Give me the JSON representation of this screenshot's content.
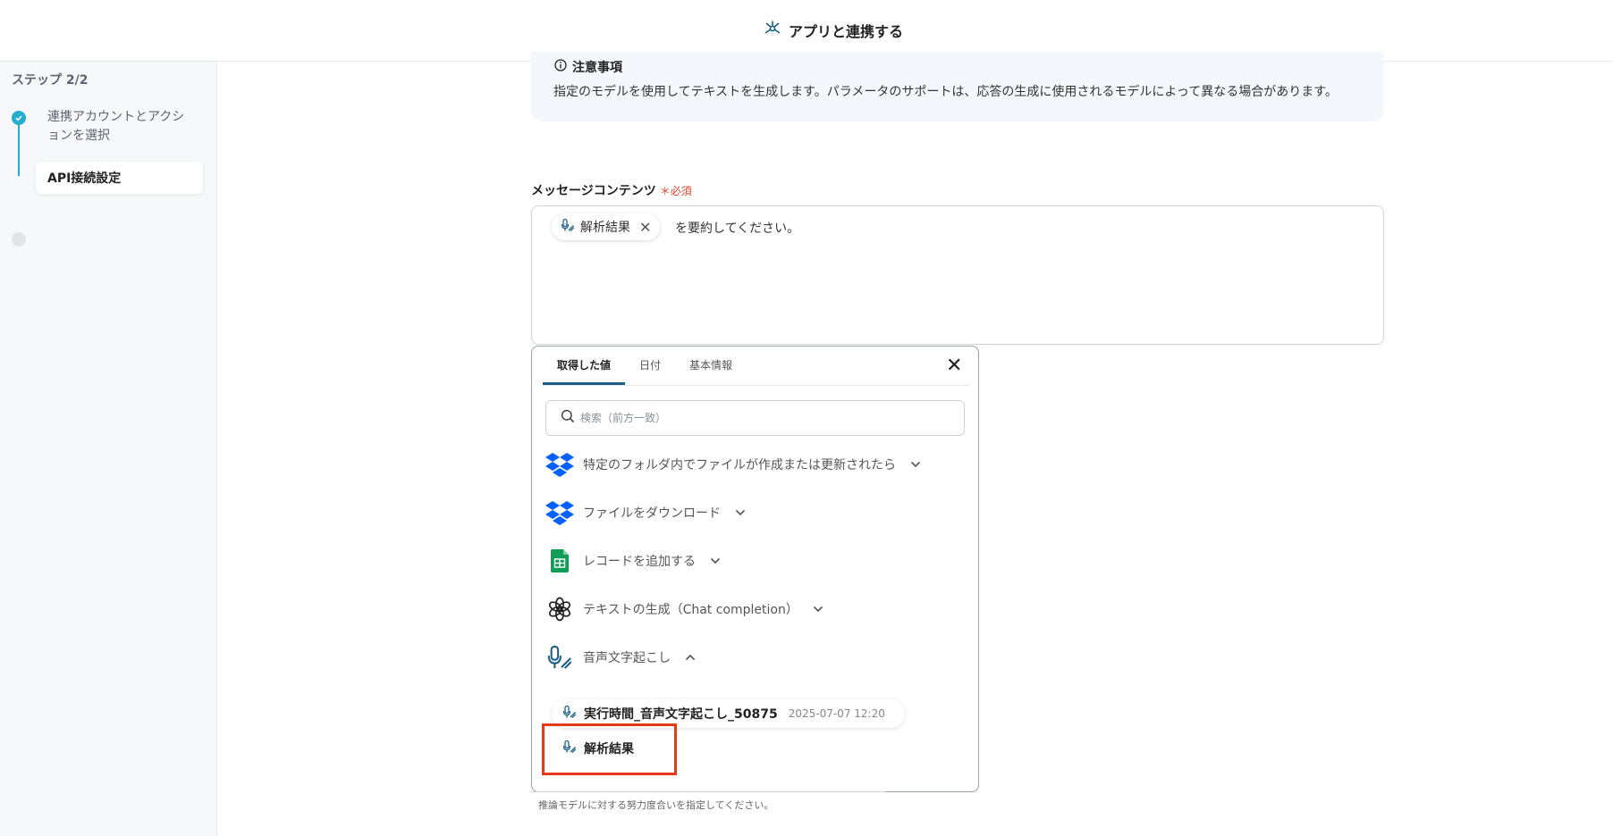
{
  "header": {
    "title": "アプリと連携する",
    "icon": "hub-icon"
  },
  "sidebar": {
    "step_label": "ステップ 2/2",
    "steps": [
      {
        "label": "連携アカウントとアクションを選択",
        "status": "done"
      },
      {
        "label": "API接続設定",
        "status": "current"
      }
    ]
  },
  "notice": {
    "title": "注意事項",
    "text": "指定のモデルを使用してテキストを生成します。パラメータのサポートは、応答の生成に使用されるモデルによって異なる場合があります。"
  },
  "message_field": {
    "label": "メッセージコンテンツ",
    "required_label": "＊必須",
    "chip_label": "解析結果",
    "suffix_text": "を要約してください。"
  },
  "popup": {
    "tabs": [
      "取得した値",
      "日付",
      "基本情報"
    ],
    "active_tab": "取得した値",
    "search_placeholder": "検索（前方一致）",
    "sources": [
      {
        "label": "特定のフォルダ内でファイルが作成または更新されたら",
        "icon": "dropbox-icon",
        "expanded": false
      },
      {
        "label": "ファイルをダウンロード",
        "icon": "dropbox-icon",
        "expanded": false
      },
      {
        "label": "レコードを追加する",
        "icon": "google-sheets-icon",
        "expanded": false
      },
      {
        "label": "テキストの生成（Chat completion）",
        "icon": "openai-icon",
        "expanded": false
      },
      {
        "label": "音声文字起こし",
        "icon": "transcription-icon",
        "expanded": true
      }
    ],
    "items": [
      {
        "label": "実行時間_音声文字起こし_50875",
        "timestamp": "2025-07-07 12:20"
      },
      {
        "label": "解析結果"
      }
    ]
  },
  "hint": "推論モデルに対する努力度合いを指定してください。",
  "colors": {
    "accent": "#23aecf",
    "highlight": "#e63918",
    "tab_underline": "#1d5e86"
  }
}
